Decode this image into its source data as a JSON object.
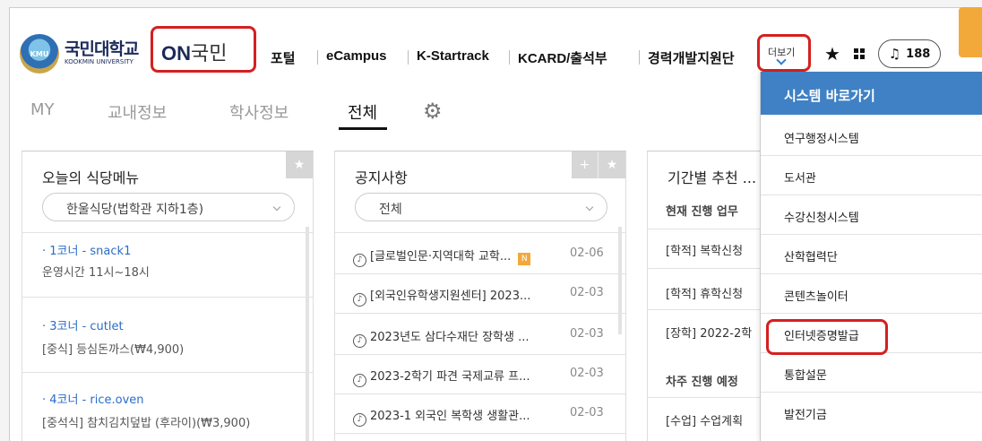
{
  "header": {
    "logo_small": "KMU",
    "logo_korean": "국민대학교",
    "logo_english": "KOOKMIN UNIVERSITY",
    "on_brand_bold": "ON",
    "on_brand_rest": "국민",
    "nav": [
      "포털",
      "eCampus",
      "K-Startrack",
      "KCARD/출석부",
      "경력개발지원단"
    ],
    "more_label": "더보기",
    "notification_count": "188"
  },
  "tabs": [
    {
      "label": "MY"
    },
    {
      "label": "교내정보"
    },
    {
      "label": "학사정보"
    },
    {
      "label": "전체"
    }
  ],
  "cafeteria": {
    "title": "오늘의 식당메뉴",
    "select_value": "한울식당(법학관 지하1층)",
    "items": [
      {
        "title": "· 1코너 - snack1",
        "detail": "운영시간 11시~18시"
      },
      {
        "title": "· 3코너 - cutlet",
        "detail": "[중식] 등심돈까스(₩4,900)"
      },
      {
        "title": "· 4코너 - rice.oven",
        "detail": "[중석식] 참치김치덮밥 (후라이)(₩3,900)"
      }
    ]
  },
  "notices": {
    "title": "공지사항",
    "select_value": "전체",
    "new_badge": "N",
    "items": [
      {
        "title": "[글로벌인문·지역대학 교학...",
        "date": "02-06",
        "is_new": true
      },
      {
        "title": "[외국인유학생지원센터] 2023...",
        "date": "02-03"
      },
      {
        "title": "2023년도 삼다수재단 장학생 ...",
        "date": "02-03"
      },
      {
        "title": "2023-2학기 파견 국제교류 프...",
        "date": "02-03"
      },
      {
        "title": "2023-1 외국인 복학생 생활관...",
        "date": "02-03"
      }
    ]
  },
  "schedule": {
    "title": "기간별 추천 ...",
    "current_heading": "현재 진행 업무",
    "items": [
      "[학적] 복학신청",
      "[학적] 휴학신청",
      "[장학] 2022-2학"
    ],
    "next_heading": "차주 진행 예정",
    "next_items": [
      "[수업] 수업계획"
    ]
  },
  "dropdown": {
    "header": "시스템 바로가기",
    "items": [
      "연구행정시스템",
      "도서관",
      "수강신청시스템",
      "산학협력단",
      "콘텐츠놀이터",
      "인터넷증명발급",
      "통합설문",
      "발전기금"
    ]
  },
  "colors": {
    "accent_blue": "#3f81c4",
    "highlight_red": "#d42020",
    "menu_link_blue": "#2a6cc7",
    "badge_orange": "#f2a93a"
  },
  "icons": [
    "bell-icon",
    "star-icon",
    "grid-icon",
    "gear-icon",
    "speaker-icon",
    "chevron-down-icon"
  ]
}
